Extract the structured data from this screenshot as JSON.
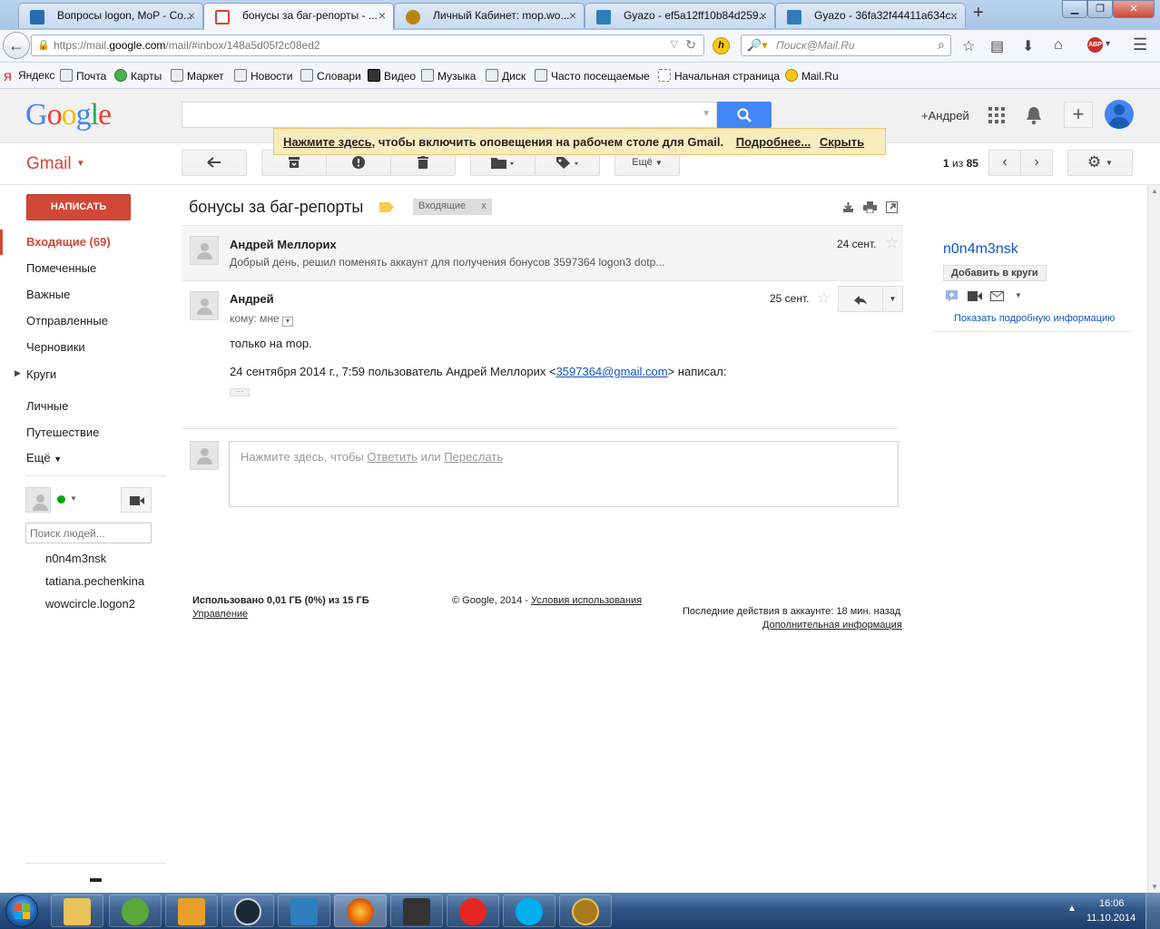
{
  "browser": {
    "tabs": [
      {
        "label": "Вопросы logon, MoP - Co...",
        "icon": "forum-icon",
        "color": "#2b6ab0"
      },
      {
        "label": "бонусы за баг-репорты - ...",
        "icon": "gmail-icon",
        "color": "#d14836",
        "active": true
      },
      {
        "label": "Личный Кабинет: mop.wo...",
        "icon": "wow-icon",
        "color": "#b8860b"
      },
      {
        "label": "Gyazo - ef5a12ff10b84d259...",
        "icon": "gyazo-icon",
        "color": "#2e7dbd"
      },
      {
        "label": "Gyazo - 36fa32f44411a634c...",
        "icon": "gyazo-icon",
        "color": "#2e7dbd"
      }
    ],
    "close_glyph": "×",
    "new_tab_glyph": "+",
    "url_prefix": "https://mail.",
    "url_domain": "google.com",
    "url_rest": "/mail/#inbox/148a5d05f2c08ed2",
    "search_placeholder": "Поиск@Mail.Ru",
    "bookmarks": [
      "Яндекс",
      "Почта",
      "Карты",
      "Маркет",
      "Новости",
      "Словари",
      "Видео",
      "Музыка",
      "Диск",
      "Часто посещаемые",
      "Начальная страница",
      "Mail.Ru"
    ]
  },
  "gmail": {
    "logo_letters": [
      "G",
      "o",
      "o",
      "g",
      "l",
      "e"
    ],
    "logo_colors": [
      "#4285f4",
      "#ea4335",
      "#fbbc05",
      "#4285f4",
      "#34a853",
      "#ea4335"
    ],
    "brand": "Gmail",
    "user_link": "+Андрей",
    "banner": {
      "link1": "Нажмите здесь",
      "text": ", чтобы включить оповещения на рабочем столе для Gmail.",
      "link2": "Подробнее...",
      "link3": "Скрыть"
    },
    "toolbar": {
      "more": "Ещё",
      "pager_pos": "1",
      "pager_sep": " из ",
      "pager_total": "85"
    },
    "compose": "НАПИСАТЬ",
    "nav": [
      "Входящие (69)",
      "Помеченные",
      "Важные",
      "Отправленные",
      "Черновики",
      "Круги",
      "Личные",
      "Путешествие",
      "Ещё"
    ],
    "people_search_placeholder": "Поиск людей...",
    "contacts": [
      "n0n4m3nsk",
      "tatiana.pechenkina",
      "wowcircle.logon2"
    ],
    "thread": {
      "subject": "бонусы за баг-репорты",
      "label": "Входящие",
      "label_close": "x",
      "msg1": {
        "sender": "Андрей Меллорих",
        "date": "24 сент.",
        "snippet": "Добрый день, решил поменять аккаунт для получения бонусов 3597364 logon3 dotp..."
      },
      "msg2": {
        "sender": "Андрей",
        "date": "25 сент.",
        "to": "кому: мне",
        "body": "только на mop.",
        "quote_prefix": "24 сентября 2014 г., 7:59 пользователь Андрей Меллорих <",
        "quote_email": "3597364@gmail.com",
        "quote_suffix": "> написал:",
        "ellipsis": "···"
      },
      "reply_prompt": {
        "pre": "Нажмите здесь, чтобы ",
        "reply": "Ответить",
        "mid": " или ",
        "forward": "Переслать"
      }
    },
    "footer": {
      "usage": "Использовано 0,01 ГБ (0%) из 15 ГБ",
      "manage": "Управление",
      "copyright": "© Google, 2014 - ",
      "terms": "Условия использования",
      "activity": "Последние действия в аккаунте: 18 мин. назад",
      "details": "Дополнительная информация"
    },
    "side": {
      "name": "n0n4m3nsk",
      "add_circles": "Добавить в круги",
      "show_info": "Показать подробную информацию"
    }
  },
  "taskbar": {
    "time": "16:06",
    "date": "11.10.2014"
  }
}
